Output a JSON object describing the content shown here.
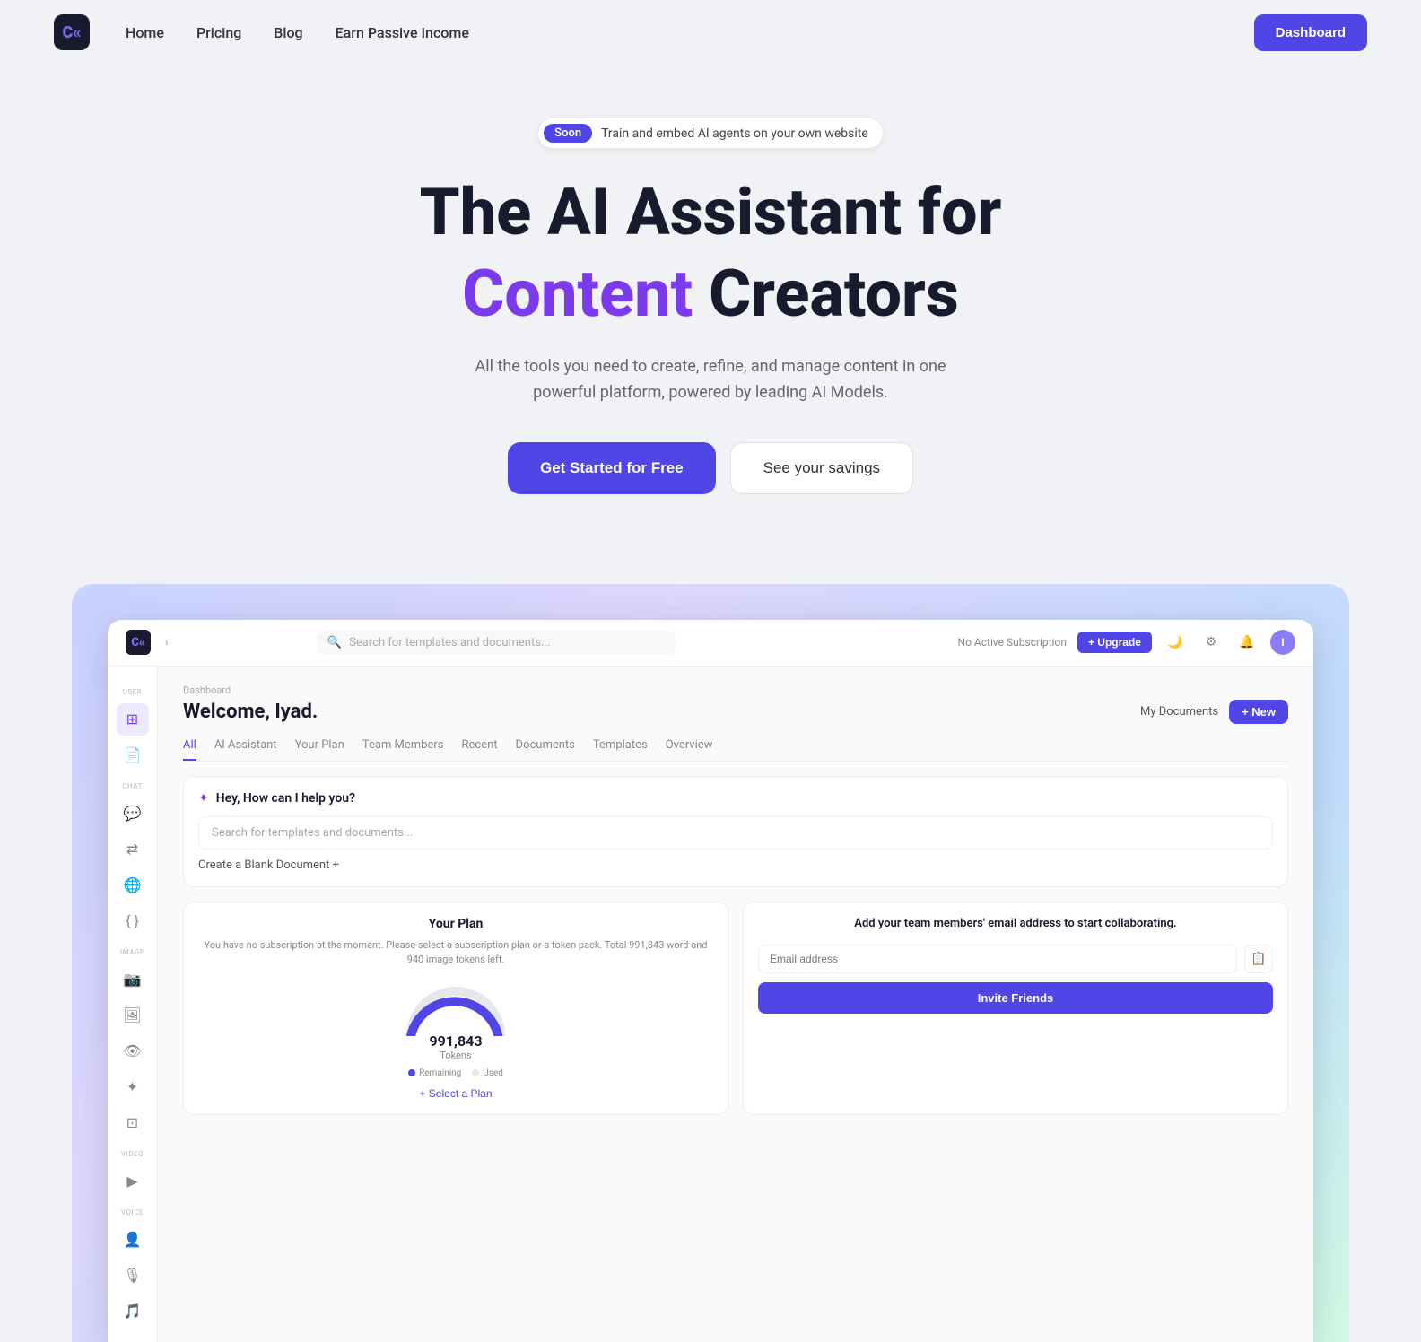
{
  "navbar": {
    "logo_text": "C«",
    "links": [
      {
        "label": "Home",
        "name": "nav-home"
      },
      {
        "label": "Pricing",
        "name": "nav-pricing"
      },
      {
        "label": "Blog",
        "name": "nav-blog"
      },
      {
        "label": "Earn Passive Income",
        "name": "nav-earn"
      }
    ],
    "dashboard_btn": "Dashboard"
  },
  "hero": {
    "badge_pill": "Soon",
    "badge_text": "Train and embed AI agents on your own website",
    "title_line1": "The AI Assistant for",
    "title_line2_purple": "Content",
    "title_line2_rest": " Creators",
    "subtitle": "All the tools you need to create, refine, and manage content in one powerful platform, powered by leading AI Models.",
    "btn_primary": "Get Started for Free",
    "btn_secondary": "See your savings"
  },
  "dashboard": {
    "topbar": {
      "logo": "C«",
      "chevron": "›",
      "search_placeholder": "Search for templates and documents...",
      "subscription_label": "No Active Subscription",
      "upgrade_btn": "+ Upgrade"
    },
    "sidebar": {
      "user_label": "USER",
      "chat_label": "CHAT",
      "image_label": "IMAGE",
      "video_label": "VIDEO",
      "voice_label": "VOICE"
    },
    "main": {
      "breadcrumb": "Dashboard",
      "welcome_title": "Welcome, Iyad.",
      "my_documents": "My Documents",
      "new_btn": "+ New",
      "tabs": [
        "All",
        "AI Assistant",
        "Your Plan",
        "Team Members",
        "Recent",
        "Documents",
        "Templates",
        "Overview"
      ],
      "active_tab": "All",
      "ai_card": {
        "title": "Hey, How can I help you?",
        "search_placeholder": "Search for templates and documents...",
        "create_blank": "Create a Blank Document +"
      },
      "plan_card": {
        "title": "Your Plan",
        "desc": "You have no subscription at the moment. Please select a subscription plan or a token pack. Total 991,843 word and 940 image tokens left.",
        "tokens_number": "991,843",
        "tokens_label": "Tokens",
        "legend_remaining": "Remaining",
        "legend_used": "Used",
        "select_plan_btn": "+ Select a Plan"
      },
      "team_card": {
        "title": "Add your team members' email address to start collaborating.",
        "input_placeholder": "Email address",
        "invite_btn": "Invite Friends"
      }
    }
  }
}
